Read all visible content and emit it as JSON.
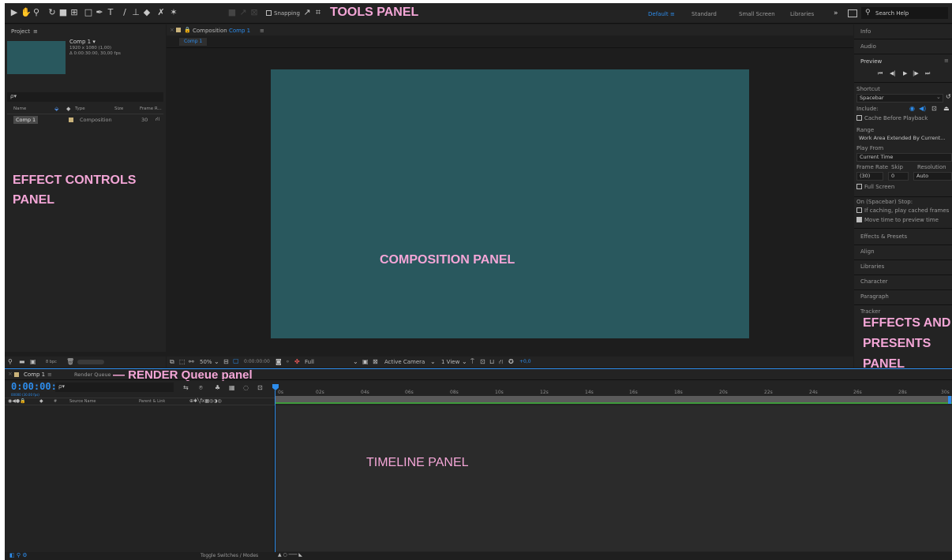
{
  "annotations": {
    "tools": "TOOLS PANEL",
    "effect_controls_1": "EFFECT CONTROLS",
    "effect_controls_2": "PANEL",
    "composition": "COMPOSITION PANEL",
    "render_queue": "— RENDER Queue panel",
    "timeline": "TIMELINE PANEL",
    "effects_1": "EFFECTS AND",
    "effects_2": "PRESENTS",
    "effects_3": "PANEL"
  },
  "toolbar": {
    "snapping": "Snapping",
    "workspaces": [
      "Default",
      "Standard",
      "Small Screen",
      "Libraries"
    ],
    "active_workspace": "Default",
    "more": "»",
    "search_placeholder": "Search Help"
  },
  "project": {
    "tab": "Project",
    "comp_name": "Comp 1 ▾",
    "comp_size": "1920 x 1080 (1,00)",
    "comp_duration": "Δ 0:00:30:00, 30,00 fps",
    "search_icon_text": "ρ▾",
    "columns": [
      "Name",
      "Type",
      "Size",
      "Frame R..."
    ],
    "item": {
      "name": "Comp 1",
      "type": "Composition",
      "fps": "30"
    },
    "bpc": "8 bpc"
  },
  "composition": {
    "tab_label": "Composition",
    "comp_link": "Comp 1",
    "subtab": "Comp 1",
    "zoom": "50%",
    "timecode": "0:00:00:00",
    "resolution": "Full",
    "camera": "Active Camera",
    "views": "1 View",
    "exposure": "+0,0"
  },
  "right_panel": {
    "info": "Info",
    "audio": "Audio",
    "preview": "Preview",
    "shortcut_label": "Shortcut",
    "shortcut_value": "Spacebar",
    "include_label": "Include:",
    "cache_before": "Cache Before Playback",
    "range_label": "Range",
    "range_value": "Work Area Extended By Current...",
    "play_from_label": "Play From",
    "play_from_value": "Current Time",
    "frame_rate_label": "Frame Rate",
    "skip_label": "Skip",
    "resolution_label": "Resolution",
    "frame_rate_value": "(30)",
    "skip_value": "0",
    "resolution_value": "Auto",
    "full_screen": "Full Screen",
    "stop_label": "On (Spacebar) Stop:",
    "if_caching": "If caching, play cached frames",
    "move_time": "Move time to preview time",
    "sections": [
      "Effects & Presets",
      "Align",
      "Libraries",
      "Character",
      "Paragraph",
      "Tracker"
    ]
  },
  "timeline": {
    "tab": "Comp 1",
    "render_tab": "Render Queue",
    "timecode": "0:00:00:00",
    "timecode_sub": "00000 (30.00 fps)",
    "search_icon_text": "ρ▾",
    "col_source": "Source Name",
    "col_parent": "Parent & Link",
    "ticks": [
      "0s",
      "02s",
      "04s",
      "06s",
      "08s",
      "10s",
      "12s",
      "14s",
      "16s",
      "18s",
      "20s",
      "22s",
      "24s",
      "26s",
      "28s",
      "30s"
    ],
    "toggle_modes": "Toggle Switches / Modes"
  },
  "colors": {
    "comp_bg": "#29585e",
    "accent_blue": "#2d8ceb",
    "annotation": "#f4a6d7",
    "work_area_green": "#3f9b3c"
  }
}
